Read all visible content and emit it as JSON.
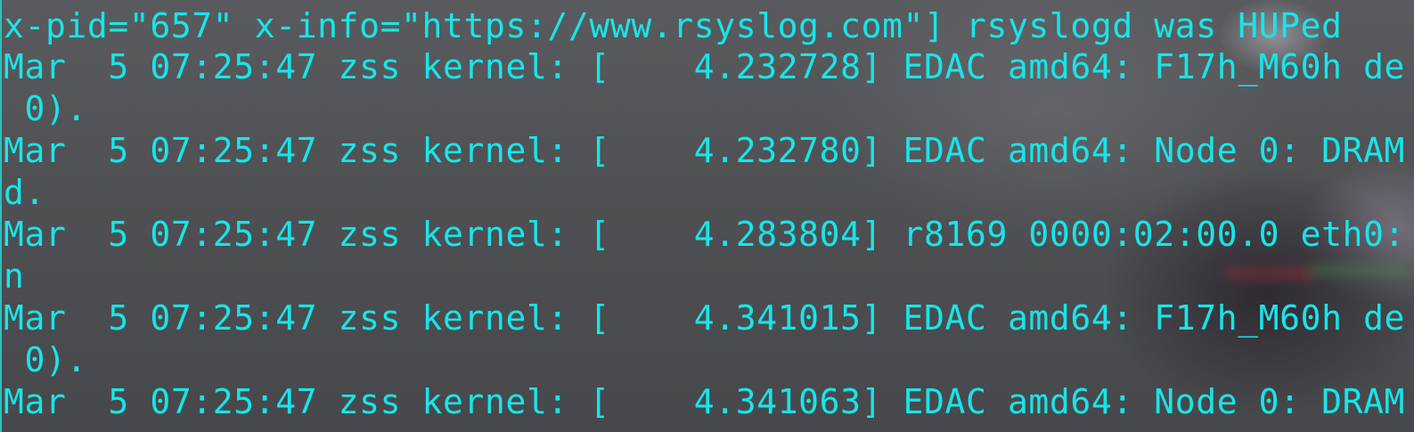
{
  "terminal": {
    "lines": [
      "x-pid=\"657\" x-info=\"https://www.rsyslog.com\"] rsyslogd was HUPed",
      "Mar  5 07:25:47 zss kernel: [    4.232728] EDAC amd64: F17h_M60h de",
      " 0).",
      "Mar  5 07:25:47 zss kernel: [    4.232780] EDAC amd64: Node 0: DRAM",
      "d.",
      "Mar  5 07:25:47 zss kernel: [    4.283804] r8169 0000:02:00.0 eth0:",
      "n",
      "Mar  5 07:25:47 zss kernel: [    4.341015] EDAC amd64: F17h_M60h de",
      " 0).",
      "Mar  5 07:25:47 zss kernel: [    4.341063] EDAC amd64: Node 0: DRAM"
    ],
    "text_color": "#16e6ea",
    "background_color": "#555658"
  }
}
